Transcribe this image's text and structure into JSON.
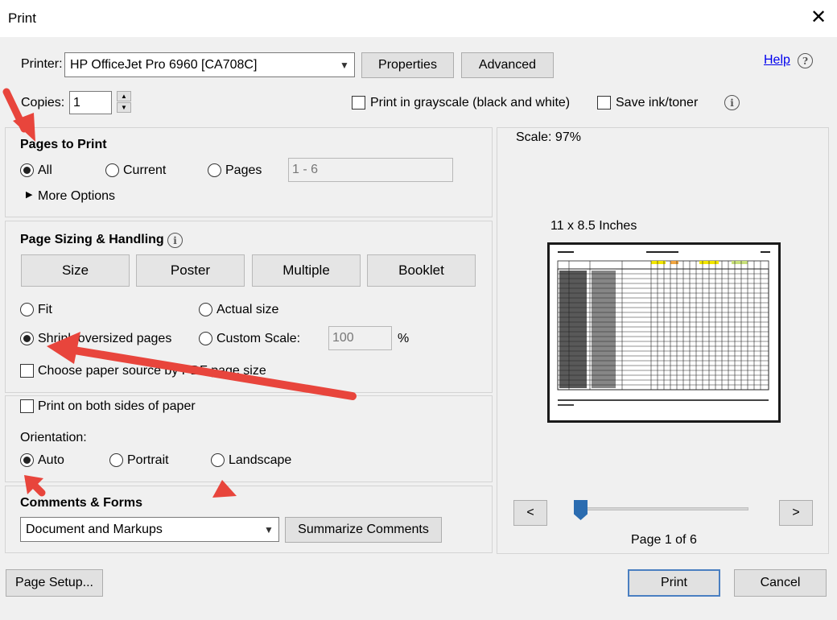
{
  "dialog": {
    "title": "Print",
    "close_glyph": "✕"
  },
  "printer": {
    "label": "Printer:",
    "selected": "HP OfficeJet Pro 6960 [CA708C]",
    "properties_label": "Properties",
    "advanced_label": "Advanced",
    "help_label": "Help",
    "copies_label": "Copies:",
    "copies_value": "1",
    "grayscale_label": "Print in grayscale (black and white)",
    "grayscale_checked": false,
    "save_ink_label": "Save ink/toner",
    "save_ink_checked": false
  },
  "pages_to_print": {
    "heading": "Pages to Print",
    "all_label": "All",
    "current_label": "Current",
    "pages_label": "Pages",
    "range_value": "1 - 6",
    "selected": "all",
    "more_options_label": "More Options"
  },
  "page_sizing": {
    "heading": "Page Sizing & Handling",
    "size_label": "Size",
    "poster_label": "Poster",
    "multiple_label": "Multiple",
    "booklet_label": "Booklet",
    "fit_label": "Fit",
    "actual_size_label": "Actual size",
    "shrink_label": "Shrink oversized pages",
    "custom_scale_label": "Custom Scale:",
    "custom_scale_value": "100",
    "percent_label": "%",
    "selected": "shrink",
    "paper_source_label": "Choose paper source by PDF page size",
    "paper_source_checked": false
  },
  "duplex": {
    "both_sides_label": "Print on both sides of paper",
    "both_sides_checked": false,
    "orientation_label": "Orientation:",
    "auto_label": "Auto",
    "portrait_label": "Portrait",
    "landscape_label": "Landscape",
    "selected": "auto"
  },
  "comments_forms": {
    "heading": "Comments & Forms",
    "selected": "Document and Markups",
    "summarize_label": "Summarize Comments"
  },
  "preview": {
    "scale_label": "Scale:  97%",
    "paper_size_label": "11 x 8.5 Inches",
    "prev_label": "<",
    "next_label": ">",
    "page_indicator": "Page 1 of 6",
    "slider_position": 0
  },
  "footer": {
    "page_setup_label": "Page Setup...",
    "print_label": "Print",
    "cancel_label": "Cancel"
  },
  "colors": {
    "annotation_arrow": "#e8453c",
    "slider_thumb": "#2b6cb0",
    "link": "#0000ee"
  }
}
